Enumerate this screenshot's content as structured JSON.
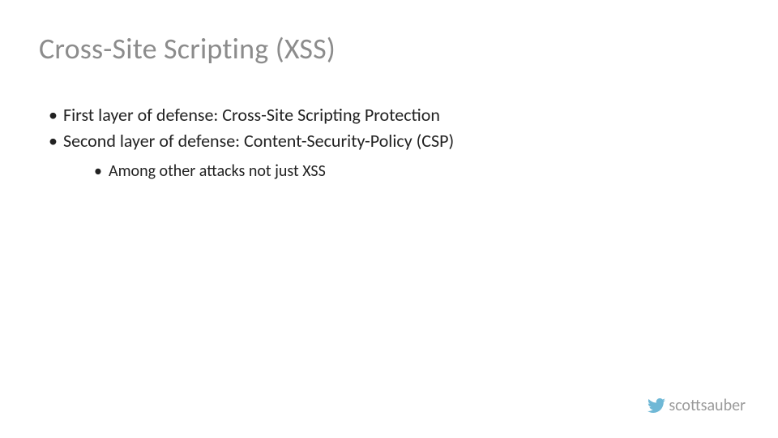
{
  "slide": {
    "title": "Cross-Site Scripting (XSS)",
    "bullets": [
      {
        "text": "First layer of defense: Cross-Site Scripting Protection"
      },
      {
        "text": "Second layer of defense: Content-Security-Policy (CSP)",
        "sub": [
          {
            "text": "Among other attacks not just XSS"
          }
        ]
      }
    ]
  },
  "footer": {
    "handle": "scottsauber",
    "icon": "twitter-icon"
  }
}
